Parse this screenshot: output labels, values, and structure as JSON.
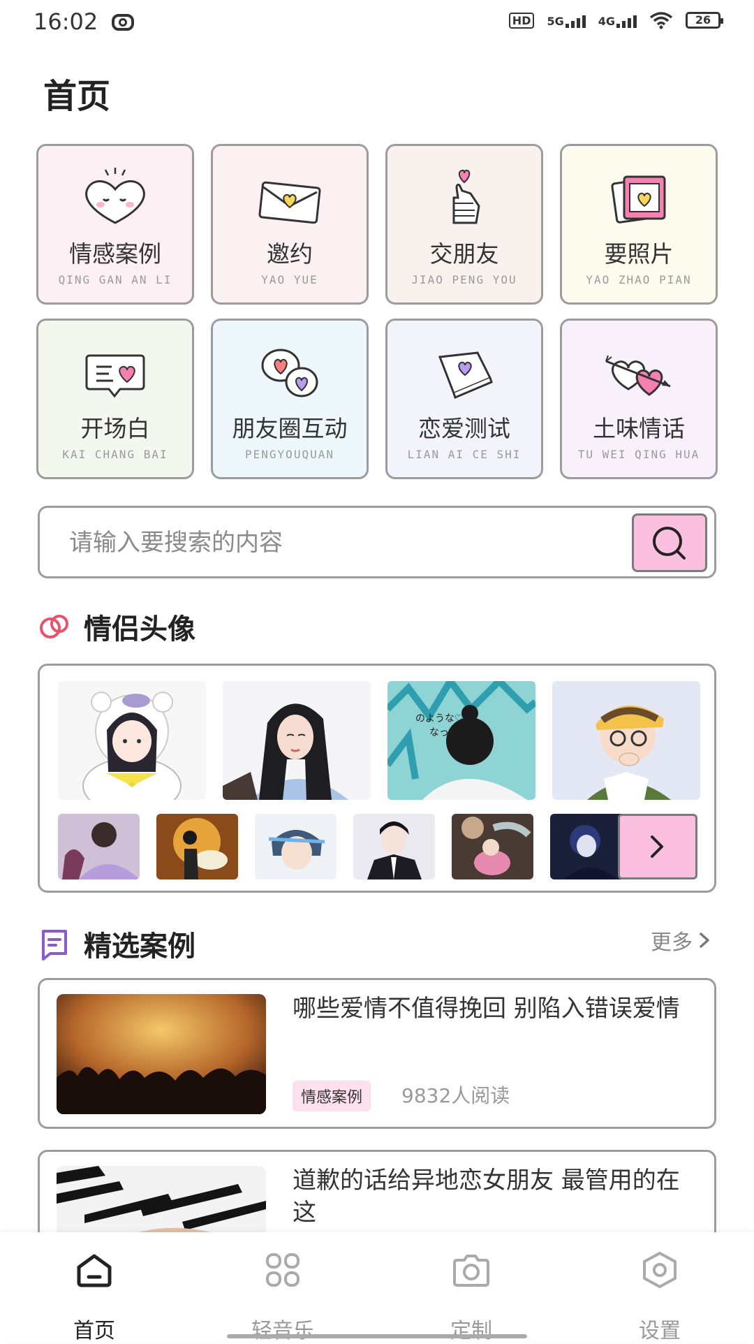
{
  "status": {
    "time": "16:02",
    "network_hd": "HD",
    "sig1": "5G",
    "sig2": "4G",
    "battery": "26"
  },
  "page_title": "首页",
  "categories": [
    {
      "cn": "情感案例",
      "py": "QING GAN AN LI",
      "bg": "#fdf0f5",
      "icon": "heart-face-icon"
    },
    {
      "cn": "邀约",
      "py": "YAO YUE",
      "bg": "#fbf0f2",
      "icon": "envelope-icon"
    },
    {
      "cn": "交朋友",
      "py": "JIAO PENG YOU",
      "bg": "#f8f1ee",
      "icon": "finger-heart-icon"
    },
    {
      "cn": "要照片",
      "py": "YAO ZHAO PIAN",
      "bg": "#fcfbee",
      "icon": "photo-icon"
    },
    {
      "cn": "开场白",
      "py": "KAI CHANG BAI",
      "bg": "#f2f8ef",
      "icon": "message-heart-icon"
    },
    {
      "cn": "朋友圈互动",
      "py": "PENGYOUQUAN",
      "bg": "#eef8fc",
      "icon": "chat-bubbles-icon"
    },
    {
      "cn": "恋爱测试",
      "py": "LIAN AI CE SHI",
      "bg": "#f3f3fb",
      "icon": "book-heart-icon"
    },
    {
      "cn": "土味情话",
      "py": "TU WEI QING HUA",
      "bg": "#f8f1fb",
      "icon": "arrow-hearts-icon"
    }
  ],
  "search": {
    "placeholder": "请输入要搜索的内容"
  },
  "avatars_section": {
    "title": "情侣头像"
  },
  "cases_section": {
    "title": "精选案例",
    "more": "更多"
  },
  "articles": [
    {
      "title": "哪些爱情不值得挽回 别陷入错误爱情",
      "tag": "情感案例",
      "reads": "9832人阅读"
    },
    {
      "title": "道歉的话给异地恋女朋友 最管用的在这",
      "tag": "",
      "reads": ""
    }
  ],
  "nav": [
    {
      "label": "首页",
      "icon": "home-icon",
      "active": true
    },
    {
      "label": "轻音乐",
      "icon": "grid-icon",
      "active": false
    },
    {
      "label": "定制",
      "icon": "camera-icon",
      "active": false
    },
    {
      "label": "设置",
      "icon": "settings-icon",
      "active": false
    }
  ],
  "colors": {
    "accent_pink": "#fbc0df",
    "border": "#9c9c9c",
    "nav_active": "#222222",
    "nav_inactive": "#999999"
  }
}
